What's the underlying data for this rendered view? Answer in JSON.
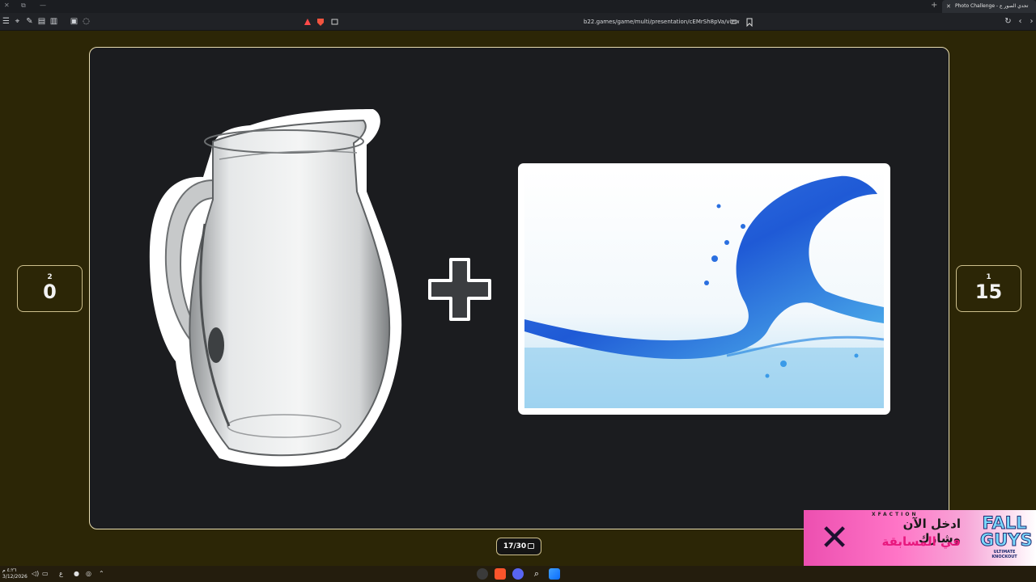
{
  "browser": {
    "tab_title": "Photo Challenge - تحدي الصور ع",
    "url": "b22.games/game/multi/presentation/cEMrSh8pVa/view"
  },
  "game": {
    "left_score": {
      "rank": "2",
      "points": "0"
    },
    "right_score": {
      "rank": "1",
      "points": "15"
    },
    "progress": "17/30",
    "clue_items": [
      "glass-pitcher",
      "plus-sign",
      "water-splash"
    ]
  },
  "ad": {
    "brand": "XFACTION",
    "line1": "ادخل الآن وشارك",
    "line2": "في المسابقة",
    "game_title": "FALL GUYS",
    "game_subtitle": "ULTIMATE KNOCKOUT"
  },
  "taskbar": {
    "time": "٤:٢٦ م",
    "date": "3/12/2026",
    "lang": "ع"
  }
}
